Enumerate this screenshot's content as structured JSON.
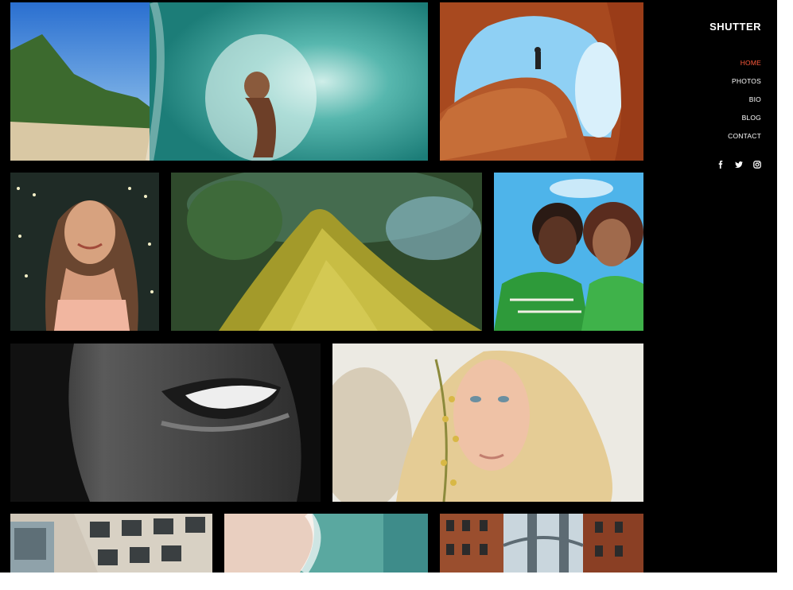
{
  "brand": "SHUTTER",
  "nav": [
    {
      "label": "HOME",
      "active": true
    },
    {
      "label": "PHOTOS",
      "active": false
    },
    {
      "label": "BIO",
      "active": false
    },
    {
      "label": "BLOG",
      "active": false
    },
    {
      "label": "CONTACT",
      "active": false
    }
  ],
  "social": [
    "facebook-icon",
    "twitter-icon",
    "instagram-icon"
  ],
  "colors": {
    "background": "#000000",
    "text": "#ffffff",
    "active_nav": "#ff5a3c"
  },
  "gallery": [
    {
      "name": "photo-surfer-wave"
    },
    {
      "name": "photo-rock-arch"
    },
    {
      "name": "photo-woman-string-lights"
    },
    {
      "name": "photo-mossy-tree-trunk"
    },
    {
      "name": "photo-two-women-smiling"
    },
    {
      "name": "photo-smile-closeup-bw"
    },
    {
      "name": "photo-blonde-woman-flowers"
    },
    {
      "name": "photo-building-facade"
    },
    {
      "name": "photo-ocean-aerial"
    },
    {
      "name": "photo-bridge-street"
    }
  ]
}
